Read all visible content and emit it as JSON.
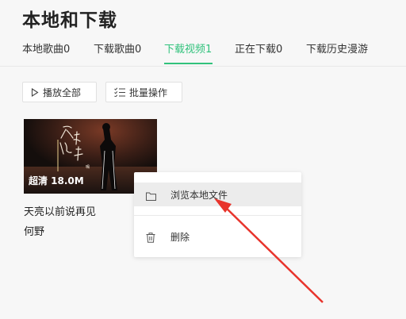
{
  "page": {
    "title": "本地和下载"
  },
  "tabs": [
    {
      "label": "本地歌曲0"
    },
    {
      "label": "下载歌曲0"
    },
    {
      "label": "下载视频1"
    },
    {
      "label": "正在下载0"
    },
    {
      "label": "下载历史漫游"
    }
  ],
  "active_tab_index": 2,
  "toolbar": {
    "play_all_label": "播放全部",
    "play_all_icon": "play-icon",
    "batch_label": "批量操作",
    "batch_icon": "list-check-icon"
  },
  "video": {
    "badge": "超清 18.0M",
    "title": "天亮以前说再见",
    "artist": "何野",
    "cover_text": "天亮以前说再见"
  },
  "context_menu": {
    "items": [
      {
        "label": "浏览本地文件",
        "icon": "folder-icon"
      },
      {
        "label": "删除",
        "icon": "trash-icon"
      }
    ]
  },
  "colors": {
    "accent": "#31c27c",
    "annotation_arrow": "#e8342c",
    "background": "#f7f7f7"
  }
}
